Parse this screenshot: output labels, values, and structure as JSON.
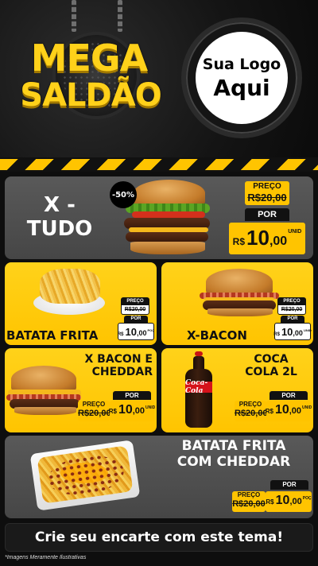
{
  "header": {
    "title_line1": "MEGA",
    "title_line2": "SALDÃO",
    "logo_line1": "Sua Logo",
    "logo_line2": "Aqui"
  },
  "products": [
    {
      "name_line1": "X -",
      "name_line2": "TUDO",
      "discount": "-50%",
      "old_label": "PREÇO",
      "old_price": "R$20,00",
      "por_label": "POR",
      "currency": "R$",
      "price_int": "10",
      "price_cents": ",00",
      "unit": "UNID"
    },
    {
      "name_line1": "BATATA FRITA",
      "old_label": "PREÇO",
      "old_price": "R$20,00",
      "por_label": "POR",
      "currency": "R$",
      "price_int": "10",
      "price_cents": ",00",
      "unit": "POÇ"
    },
    {
      "name_line1": "X-BACON",
      "old_label": "PREÇO",
      "old_price": "R$20,00",
      "por_label": "POR",
      "currency": "R$",
      "price_int": "10",
      "price_cents": ",00",
      "unit": "UNID"
    },
    {
      "name_line1": "X BACON E",
      "name_line2": "CHEDDAR",
      "old_label": "PREÇO",
      "old_price": "R$20,00",
      "por_label": "POR",
      "currency": "R$",
      "price_int": "10",
      "price_cents": ",00",
      "unit": "UNID"
    },
    {
      "name_line1": "COCA",
      "name_line2": "COLA 2L",
      "old_label": "PREÇO",
      "old_price": "R$20,00",
      "por_label": "POR",
      "currency": "R$",
      "price_int": "10",
      "price_cents": ",00",
      "unit": "UNID"
    },
    {
      "name_line1": "BATATA FRITA",
      "name_line2": "COM CHEDDAR",
      "old_label": "PREÇO",
      "old_price": "R$20,00",
      "por_label": "POR",
      "currency": "R$",
      "price_int": "10",
      "price_cents": ",00",
      "unit": "POÇ"
    }
  ],
  "bottle_brand": "Coca-Cola",
  "cta": "Crie seu encarte com este tema!",
  "disclaimer": "*Imagens Meramente Ilustrativas",
  "colors": {
    "accent": "#ffc400",
    "panel_gray": "#505050",
    "background": "#0e0e0e"
  }
}
